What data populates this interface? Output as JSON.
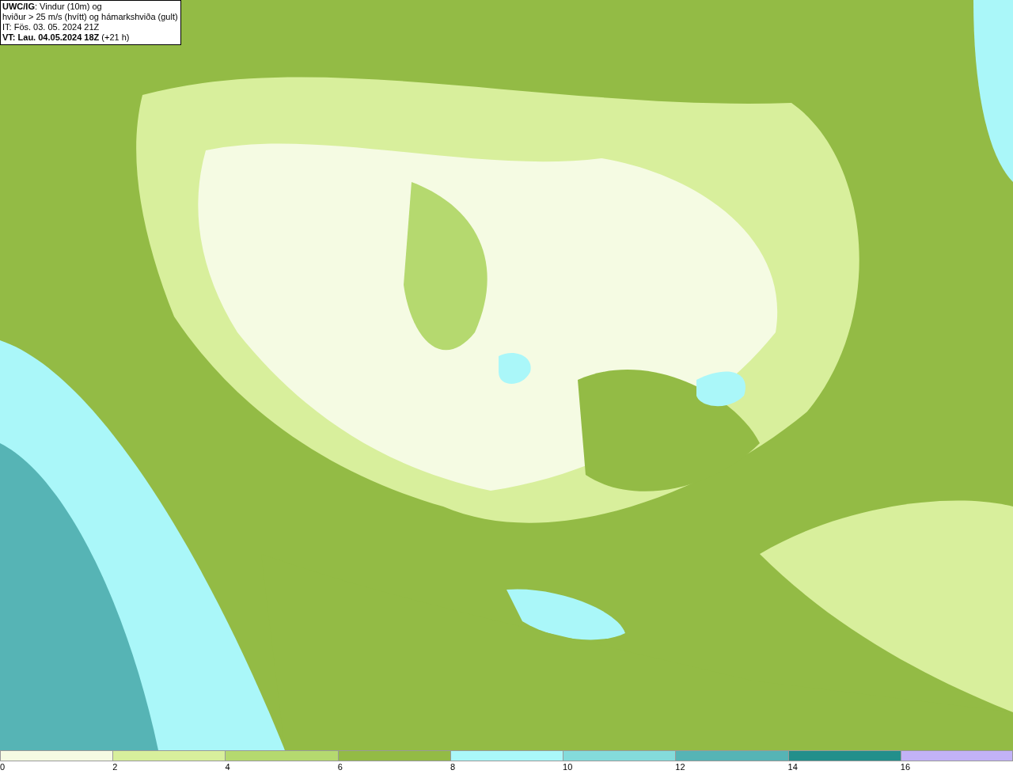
{
  "info_box": {
    "lines": [
      "**UWC/IG**: Vindur (10m) og",
      "hviður > 25 m/s (hvítt) og hámarkshviða (gult)",
      "IT: Fös. 03. 05. 2024 21Z",
      "**VT: Lau. 04.05.2024 18Z** (+21 h)"
    ]
  },
  "legend": {
    "bins": [
      {
        "label": "0",
        "color": "#f5fbe3"
      },
      {
        "label": "2",
        "color": "#d8ef9c"
      },
      {
        "label": "4",
        "color": "#b5d96f"
      },
      {
        "label": "6",
        "color": "#93bb45"
      },
      {
        "label": "8",
        "color": "#aaf7f9"
      },
      {
        "label": "10",
        "color": "#84dbdb"
      },
      {
        "label": "12",
        "color": "#56b4b5"
      },
      {
        "label": "14",
        "color": "#238f8b"
      },
      {
        "label": "16",
        "color": "#c2b2f7"
      }
    ]
  }
}
